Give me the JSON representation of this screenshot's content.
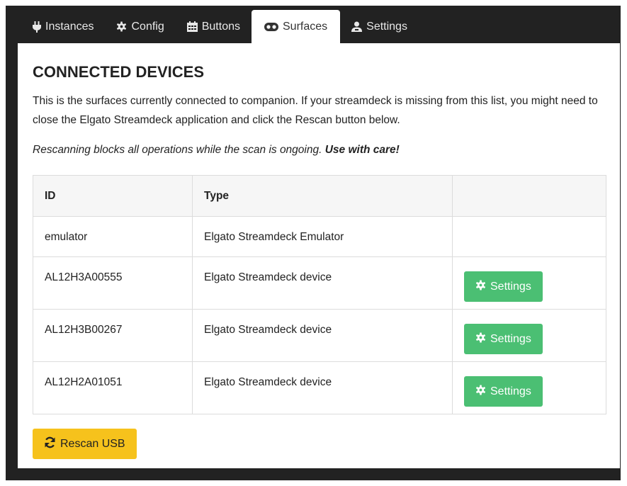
{
  "tabs": [
    {
      "label": "Instances",
      "icon": "plug-icon"
    },
    {
      "label": "Config",
      "icon": "gear-icon"
    },
    {
      "label": "Buttons",
      "icon": "calendar-grid-icon"
    },
    {
      "label": "Surfaces",
      "icon": "gamepad-icon",
      "active": true
    },
    {
      "label": "Settings",
      "icon": "user-cog-icon"
    }
  ],
  "content": {
    "heading": "CONNECTED DEVICES",
    "intro": "This is the surfaces currently connected to companion. If your streamdeck is missing from this list, you might need to close the Elgato Streamdeck application and click the Rescan button below.",
    "warning_text": "Rescanning blocks all operations while the scan is ongoing. ",
    "warning_emphasis": "Use with care!"
  },
  "table": {
    "headers": [
      "ID",
      "Type",
      ""
    ],
    "rows": [
      {
        "id": "emulator",
        "type": "Elgato Streamdeck Emulator",
        "settings": ""
      },
      {
        "id": "AL12H3A00555",
        "type": "Elgato Streamdeck device",
        "settings": "Settings"
      },
      {
        "id": "AL12H3B00267",
        "type": "Elgato Streamdeck device",
        "settings": "Settings"
      },
      {
        "id": "AL12H2A01051",
        "type": "Elgato Streamdeck device",
        "settings": "Settings"
      }
    ]
  },
  "rescan_label": "Rescan USB",
  "colors": {
    "frame": "#222222",
    "settings_button": "#4bbf73",
    "rescan_button": "#f6c21c"
  }
}
